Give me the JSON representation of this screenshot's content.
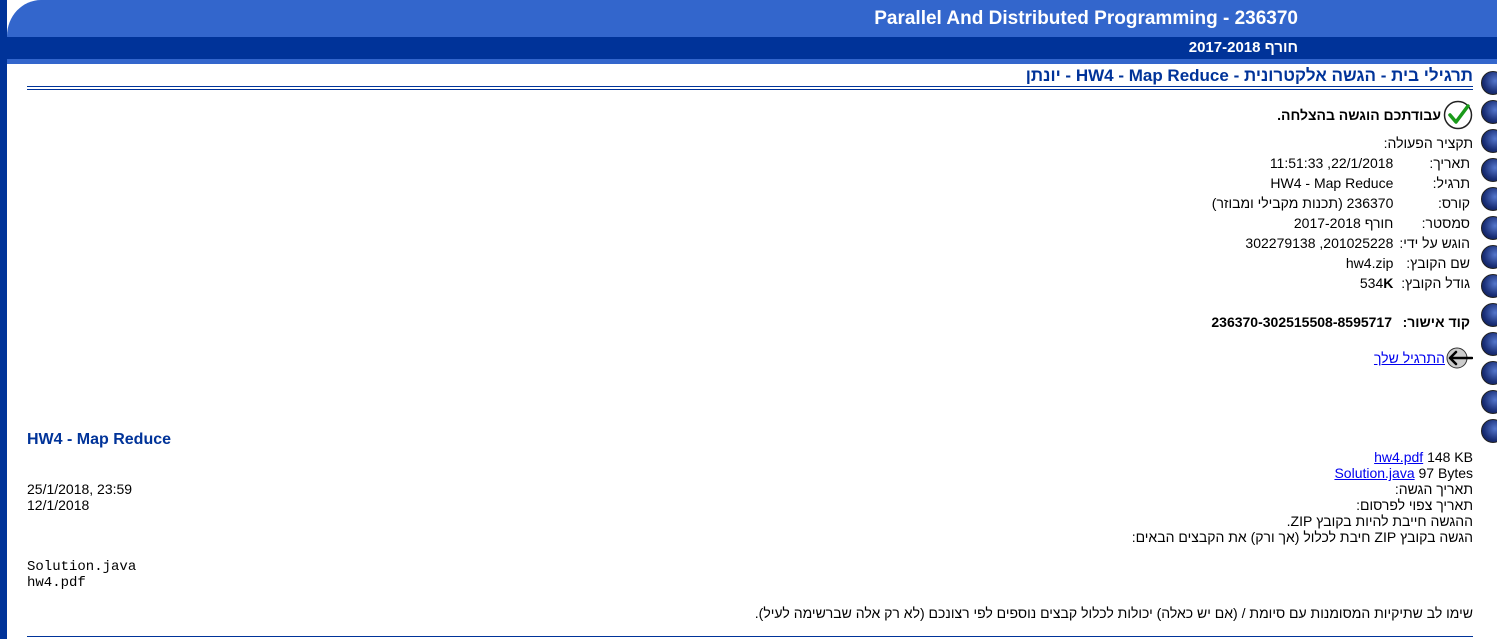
{
  "header": {
    "title": "Parallel And Distributed Programming - 236370",
    "semester": "חורף 2017-2018"
  },
  "page_heading": "תרגילי בית - הגשה אלקטרונית - HW4 - Map Reduce - יונתן",
  "success_message": "עבודתכם הוגשה בהצלחה.",
  "summary_label": "תקציר הפעולה:",
  "details": [
    {
      "key": "תאריך:",
      "value": "22/1/2018, 11:51:33"
    },
    {
      "key": "תרגיל:",
      "value": "HW4 - Map Reduce"
    },
    {
      "key": "קורס:",
      "value": "236370 (תכנות מקבילי ומבוזר)"
    },
    {
      "key": "סמסטר:",
      "value": "חורף 2017-2018"
    },
    {
      "key": "הוגש על ידי:",
      "value": "201025228, 302279138"
    },
    {
      "key": "שם הקובץ:",
      "value": "hw4.zip"
    },
    {
      "key": "גודל הקובץ:",
      "value": "534",
      "unit": "K"
    }
  ],
  "confirmation": {
    "label": "קוד אישור:",
    "value": "236370-302515508-8595717"
  },
  "next_link": "התרגיל שלך",
  "exercise": {
    "title": "HW4 - Map Reduce",
    "files": [
      {
        "name": "hw4.pdf",
        "size": "148 KB"
      },
      {
        "name": "Solution.java",
        "size": "97 Bytes"
      }
    ],
    "due_label": "תאריך הגשה:",
    "due_value": "25/1/2018, 23:59",
    "publish_label": "תאריך צפוי לפרסום:",
    "publish_value": "12/1/2018",
    "zip_note": "ההגשה חייבת להיות בקובץ ZIP.",
    "zip_contents_note": "הגשה בקובץ ZIP חיבת לכלול (אך ורק) את הקבצים הבאים:",
    "required_files": [
      "Solution.java",
      "hw4.pdf"
    ],
    "footer_note": "שימו לב שתיקיות המסומנות עם סיומת / (אם יש כאלה) יכולות לכלול קבצים נוספים לפי רצונכם (לא רק אלה שברשימה לעיל)."
  },
  "colors": {
    "dark_blue": "#003399",
    "header_blue": "#3366cc",
    "link": "#0000ee"
  }
}
